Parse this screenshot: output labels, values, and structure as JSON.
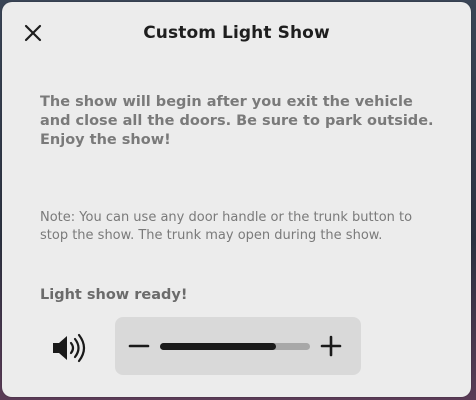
{
  "dialog": {
    "title": "Custom Light Show",
    "message": "The show will begin after you exit the vehicle and close all the doors. Be sure to park outside. Enjoy the show!",
    "note": "Note: You can use any door handle or the trunk button to stop the show. The trunk may open during the show.",
    "status": "Light show ready!"
  },
  "icons": {
    "close": "close-icon",
    "speaker": "speaker-volume-icon",
    "minus": "minus-icon",
    "plus": "plus-icon"
  },
  "volume": {
    "level": 0.77
  },
  "colors": {
    "background": "#ececec",
    "text_primary": "#1e1e1e",
    "text_secondary": "#7a7a7a",
    "control_bg": "#d9d9d9",
    "track": "#a8a8a8",
    "fill": "#1a1a1a"
  }
}
